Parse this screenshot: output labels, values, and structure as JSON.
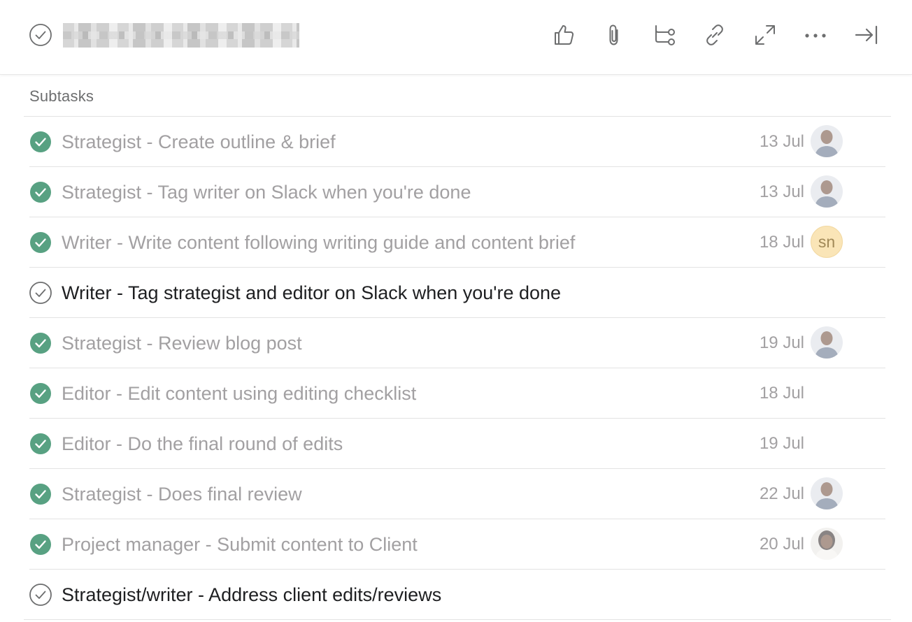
{
  "header": {
    "title_redacted": true,
    "actions": [
      {
        "name": "like-button",
        "icon": "thumbs-up-icon"
      },
      {
        "name": "attach-button",
        "icon": "paperclip-icon"
      },
      {
        "name": "add-subtask-button",
        "icon": "subtask-icon"
      },
      {
        "name": "copy-link-button",
        "icon": "link-icon"
      },
      {
        "name": "expand-button",
        "icon": "expand-icon"
      },
      {
        "name": "more-actions-button",
        "icon": "more-horizontal-icon"
      },
      {
        "name": "close-pane-button",
        "icon": "close-pane-icon"
      }
    ]
  },
  "section": {
    "label": "Subtasks"
  },
  "colors": {
    "complete_green": "#58a182",
    "muted_text": "#a2a0a2",
    "primary_text": "#1e1f21",
    "divider": "#e3e3e3",
    "initials_avatar_bg": "#f9dfa6"
  },
  "subtasks": [
    {
      "name": "Strategist - Create outline & brief",
      "done": true,
      "due": "13 Jul",
      "assignee": {
        "type": "photo",
        "icon": "man-avatar-icon"
      }
    },
    {
      "name": "Strategist - Tag writer on Slack when you're done",
      "done": true,
      "due": "13 Jul",
      "assignee": {
        "type": "photo",
        "icon": "man-avatar-icon"
      }
    },
    {
      "name": "Writer - Write content following writing guide and content brief",
      "done": true,
      "due": "18 Jul",
      "assignee": {
        "type": "initials",
        "initials": "sn"
      }
    },
    {
      "name": "Writer - Tag strategist and editor on Slack when you're done",
      "done": false,
      "due": "",
      "assignee": null
    },
    {
      "name": "Strategist - Review blog post",
      "done": true,
      "due": "19 Jul",
      "assignee": {
        "type": "photo",
        "icon": "man-avatar-icon"
      }
    },
    {
      "name": "Editor - Edit content using editing checklist",
      "done": true,
      "due": "18 Jul",
      "assignee": null
    },
    {
      "name": "Editor - Do the final round of edits",
      "done": true,
      "due": "19 Jul",
      "assignee": null
    },
    {
      "name": "Strategist - Does final review",
      "done": true,
      "due": "22 Jul",
      "assignee": {
        "type": "photo",
        "icon": "man-avatar-icon"
      }
    },
    {
      "name": "Project manager - Submit content to Client",
      "done": true,
      "due": "20 Jul",
      "assignee": {
        "type": "photo",
        "icon": "woman-avatar-icon"
      }
    },
    {
      "name": "Strategist/writer - Address client edits/reviews",
      "done": false,
      "due": "",
      "assignee": null
    }
  ]
}
